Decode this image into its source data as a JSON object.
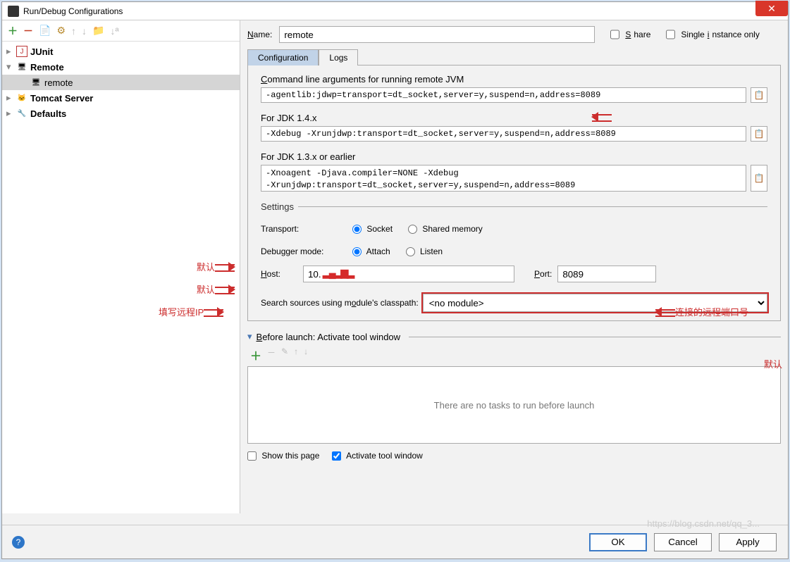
{
  "window": {
    "title": "Run/Debug Configurations"
  },
  "tree": {
    "items": [
      {
        "label": "JUnit",
        "icon": "🞎"
      },
      {
        "label": "Remote",
        "icon": "🖥",
        "expanded": true,
        "children": [
          {
            "label": "remote",
            "icon": "🖥",
            "selected": true
          }
        ]
      },
      {
        "label": "Tomcat Server",
        "icon": "🐱"
      },
      {
        "label": "Defaults",
        "icon": "🔧"
      }
    ]
  },
  "name": {
    "label": "Name:",
    "value": "remote"
  },
  "share": "Share",
  "single": "Single instance only",
  "tabs": {
    "config": "Configuration",
    "logs": "Logs"
  },
  "cmd": {
    "label": "Command line arguments for running remote JVM",
    "value": "-agentlib:jdwp=transport=dt_socket,server=y,suspend=n,address=8089"
  },
  "jdk14": {
    "label": "For JDK 1.4.x",
    "value": "-Xdebug -Xrunjdwp:transport=dt_socket,server=y,suspend=n,address=8089"
  },
  "jdk13": {
    "label": "For JDK 1.3.x or earlier",
    "value": "-Xnoagent -Djava.compiler=NONE -Xdebug\n-Xrunjdwp:transport=dt_socket,server=y,suspend=n,address=8089"
  },
  "settings": {
    "legend": "Settings",
    "transport": {
      "label": "Transport:",
      "socket": "Socket",
      "shared": "Shared memory"
    },
    "debugger": {
      "label": "Debugger mode:",
      "attach": "Attach",
      "listen": "Listen"
    },
    "host": {
      "label": "Host:",
      "value": "10."
    },
    "port": {
      "label": "Port:",
      "value": "8089"
    },
    "search": {
      "label": "Search sources using module's classpath:",
      "value": "<no module>"
    }
  },
  "before": {
    "label": "Before launch: Activate tool window",
    "empty": "There are no tasks to run before launch",
    "show": "Show this page",
    "activate": "Activate tool window"
  },
  "footer": {
    "ok": "OK",
    "cancel": "Cancel",
    "apply": "Apply"
  },
  "anno": {
    "default": "默认",
    "host_ip": "填写远程IP",
    "port_note": "连接的远程端口号"
  },
  "watermark": "https://blog.csdn.net/qq_3..."
}
